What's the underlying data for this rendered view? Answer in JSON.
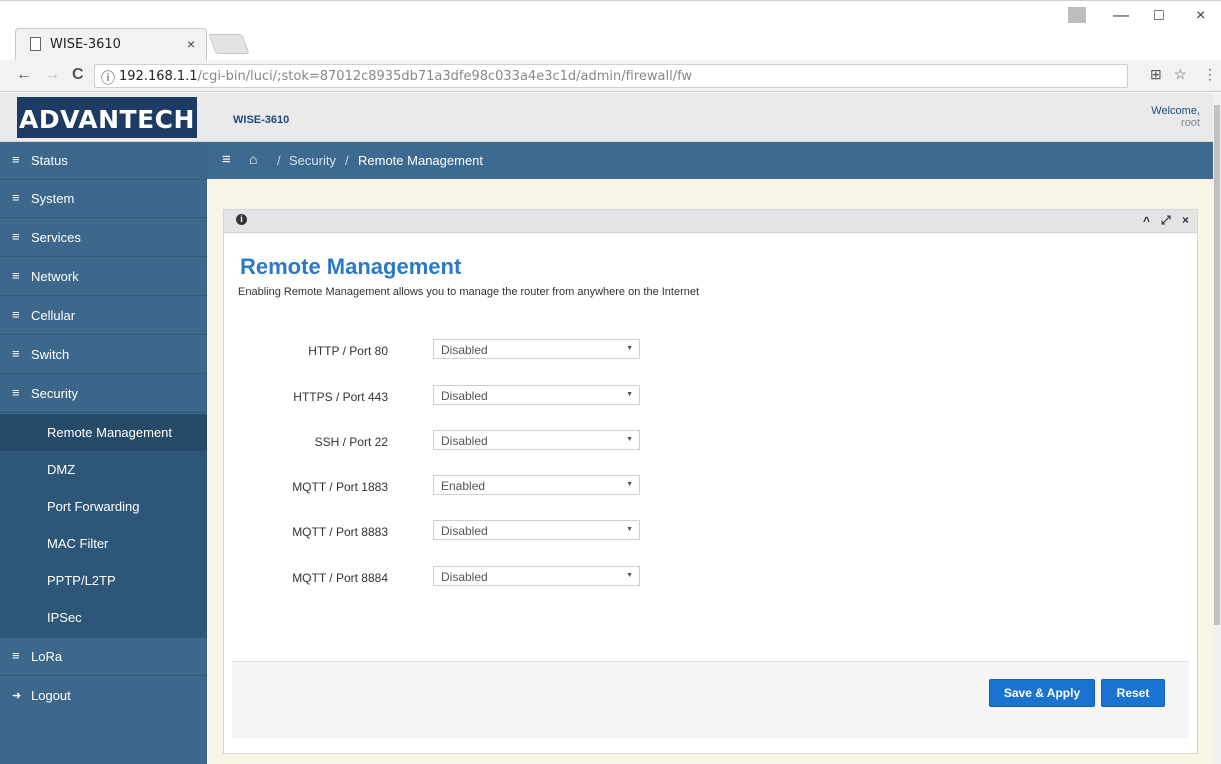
{
  "browser": {
    "tab_title": "WISE-3610",
    "tab_close": "×",
    "url_host": "192.168.1.1",
    "url_path": "/cgi-bin/luci/;stok=87012c8935db71a3dfe98c033a4e3c1d/admin/firewall/fw",
    "info_glyph": "ⓘ",
    "back_glyph": "←",
    "forward_glyph": "→",
    "reload_glyph": "C",
    "translate_glyph": "⊞",
    "star_glyph": "☆",
    "menu_glyph": "⋮",
    "minimize_glyph": "—",
    "maximize_glyph": "□",
    "close_glyph": "×"
  },
  "header": {
    "logo": "ADVANTECH",
    "product": "WISE-3610",
    "welcome": "Welcome,",
    "user": "root"
  },
  "sidebar": {
    "items": [
      {
        "label": "Status"
      },
      {
        "label": "System"
      },
      {
        "label": "Services"
      },
      {
        "label": "Network"
      },
      {
        "label": "Cellular"
      },
      {
        "label": "Switch"
      },
      {
        "label": "Security"
      },
      {
        "label": "LoRa"
      },
      {
        "label": "Logout"
      }
    ],
    "security_sub": [
      {
        "label": "Remote Management"
      },
      {
        "label": "DMZ"
      },
      {
        "label": "Port Forwarding"
      },
      {
        "label": "MAC Filter"
      },
      {
        "label": "PPTP/L2TP"
      },
      {
        "label": "IPSec"
      }
    ],
    "list_icon": "≡",
    "logout_icon": "➜"
  },
  "breadcrumb": {
    "menu_glyph": "≡",
    "home_glyph": "⌂",
    "separator": "/",
    "section": "Security",
    "current": "Remote Management"
  },
  "panel": {
    "info_glyph": "i",
    "collapse_glyph": "^",
    "expand_glyph": "⤢",
    "close_glyph": "×",
    "title": "Remote Management",
    "description": "Enabling Remote Management allows you to manage the router from anywhere on the Internet",
    "fields": [
      {
        "label": "HTTP / Port 80",
        "value": "Disabled"
      },
      {
        "label": "HTTPS / Port 443",
        "value": "Disabled"
      },
      {
        "label": "SSH / Port 22",
        "value": "Disabled"
      },
      {
        "label": "MQTT / Port 1883",
        "value": "Enabled"
      },
      {
        "label": "MQTT / Port 8883",
        "value": "Disabled"
      },
      {
        "label": "MQTT / Port 8884",
        "value": "Disabled"
      }
    ],
    "select_arrow": "▼",
    "save_apply": "Save & Apply",
    "reset": "Reset"
  },
  "colors": {
    "sidebar": "#3d678b",
    "sidebar_active": "#264a69",
    "accent": "#2a79c9",
    "button": "#1b73d1",
    "logo_bg": "#1d3b63"
  }
}
